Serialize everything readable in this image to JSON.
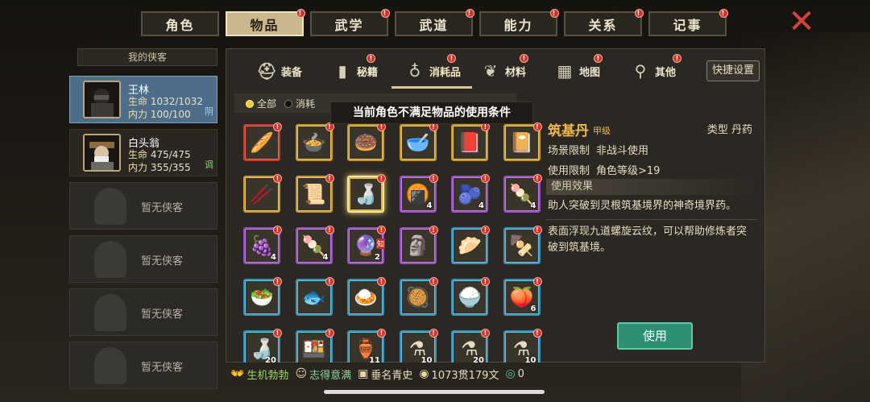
{
  "top_tabs": [
    {
      "label": "角色",
      "active": false,
      "badge": false
    },
    {
      "label": "物品",
      "active": true,
      "badge": true
    },
    {
      "label": "武学",
      "active": false,
      "badge": true
    },
    {
      "label": "武道",
      "active": false,
      "badge": true
    },
    {
      "label": "能力",
      "active": false,
      "badge": true
    },
    {
      "label": "关系",
      "active": false,
      "badge": true
    },
    {
      "label": "记事",
      "active": false,
      "badge": true
    }
  ],
  "heroes_header": "我的侠客",
  "heroes": [
    {
      "name": "王林",
      "hp_label": "生命",
      "hp": "1032/1032",
      "mp_label": "内力",
      "mp": "100/100",
      "tag": "阴"
    },
    {
      "name": "白头翁",
      "hp_label": "生命",
      "hp": "475/475",
      "mp_label": "内力",
      "mp": "355/355",
      "tag": "调"
    }
  ],
  "empty_slot_label": "暂无侠客",
  "sub_tabs": [
    {
      "label": "装备",
      "icon": "helmet-icon"
    },
    {
      "label": "秘籍",
      "icon": "book-icon"
    },
    {
      "label": "消耗品",
      "icon": "gourd-icon"
    },
    {
      "label": "材料",
      "icon": "herb-icon"
    },
    {
      "label": "地图",
      "icon": "map-icon"
    },
    {
      "label": "其他",
      "icon": "bell-icon"
    }
  ],
  "quick_settings": "快捷设置",
  "filters": {
    "all": "全部",
    "consumable": "消耗"
  },
  "tooltip": "当前角色不满足物品的使用条件",
  "items": [
    {
      "glyph": "🥖",
      "quality": "red",
      "count": ""
    },
    {
      "glyph": "🍲",
      "quality": "gold",
      "count": ""
    },
    {
      "glyph": "🍩",
      "quality": "gold",
      "count": ""
    },
    {
      "glyph": "🥣",
      "quality": "gold",
      "count": ""
    },
    {
      "glyph": "📕",
      "quality": "gold",
      "count": ""
    },
    {
      "glyph": "📔",
      "quality": "gold",
      "count": ""
    },
    {
      "glyph": "🥢",
      "quality": "gold",
      "count": ""
    },
    {
      "glyph": "📜",
      "quality": "gold",
      "count": ""
    },
    {
      "glyph": "🍶",
      "quality": "sel",
      "count": ""
    },
    {
      "glyph": "🍘",
      "quality": "purple",
      "count": "4"
    },
    {
      "glyph": "🫐",
      "quality": "purple",
      "count": "4"
    },
    {
      "glyph": "🍡",
      "quality": "purple",
      "count": "4"
    },
    {
      "glyph": "🍇",
      "quality": "purple",
      "count": "4"
    },
    {
      "glyph": "🍡",
      "quality": "purple",
      "count": "4"
    },
    {
      "glyph": "🔮",
      "quality": "purple",
      "count": "2",
      "know": "知"
    },
    {
      "glyph": "🗿",
      "quality": "purple",
      "count": ""
    },
    {
      "glyph": "🥟",
      "quality": "blue",
      "count": ""
    },
    {
      "glyph": "🍢",
      "quality": "blue",
      "count": ""
    },
    {
      "glyph": "🥗",
      "quality": "blue",
      "count": ""
    },
    {
      "glyph": "🐟",
      "quality": "blue",
      "count": ""
    },
    {
      "glyph": "🍛",
      "quality": "blue",
      "count": ""
    },
    {
      "glyph": "🥘",
      "quality": "blue",
      "count": ""
    },
    {
      "glyph": "🍚",
      "quality": "blue",
      "count": ""
    },
    {
      "glyph": "🍑",
      "quality": "blue",
      "count": "6"
    },
    {
      "glyph": "🍶",
      "quality": "blue",
      "count": "20"
    },
    {
      "glyph": "🍱",
      "quality": "blue",
      "count": ""
    },
    {
      "glyph": "🏺",
      "quality": "blue",
      "count": "11"
    },
    {
      "glyph": "⚗",
      "quality": "blue",
      "count": "10"
    },
    {
      "glyph": "⚗",
      "quality": "blue",
      "count": "20"
    },
    {
      "glyph": "⚗",
      "quality": "blue",
      "count": "10"
    }
  ],
  "detail": {
    "name": "筑基丹",
    "grade": "甲级",
    "type_label": "类型",
    "type_value": "丹药",
    "scene_label": "场景限制",
    "scene_value": "非战斗使用",
    "use_label": "使用限制",
    "use_value": "角色等级>19",
    "effect_header": "使用效果",
    "effect": "助人突破到灵根筑基境界的神奇境界药。",
    "description": "表面浮现九道螺旋云纹，可以帮助修炼者突破到筑基境。",
    "use_button": "使用"
  },
  "bottom": {
    "status1": "生机勃勃",
    "status2": "志得意满",
    "status3": "垂名青史",
    "money": "1073贯179文",
    "jade": "0"
  },
  "colors": {
    "accent_gold": "#f0b949",
    "use_button": "#2f8f72",
    "close": "#d9423a"
  }
}
